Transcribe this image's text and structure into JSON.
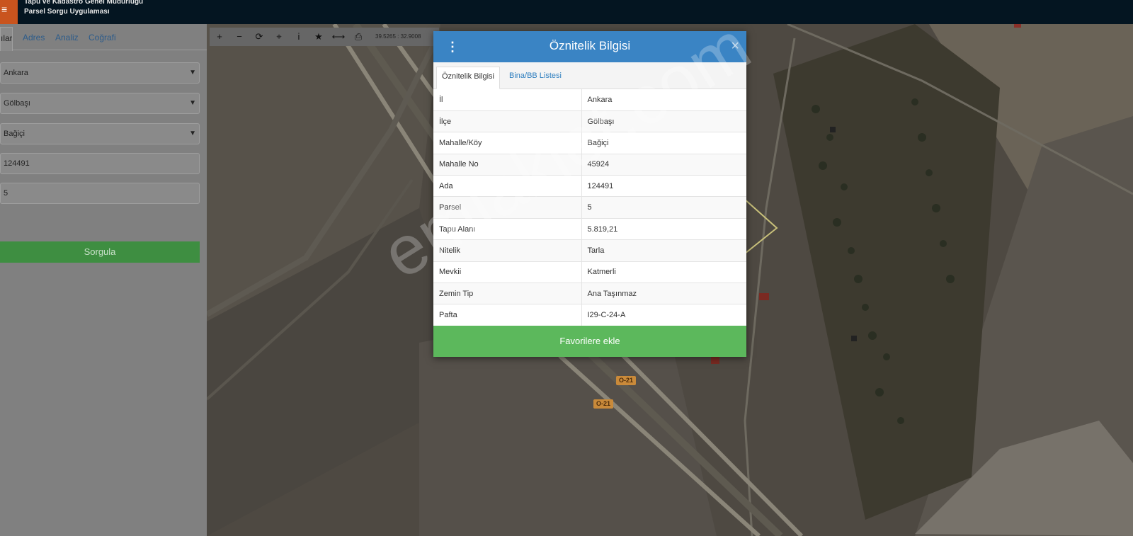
{
  "header": {
    "title_line1": "Tapu ve Kadastro Genel Müdürlüğü",
    "title_line2": "Parsel Sorgu Uygulaması",
    "menu_icon": "≡"
  },
  "sidebar": {
    "tabs": [
      {
        "label": "ıları"
      },
      {
        "label": "Adres"
      },
      {
        "label": "Analiz"
      },
      {
        "label": "Coğrafi"
      }
    ],
    "fields": [
      {
        "value": "Ankara",
        "type": "select"
      },
      {
        "value": "Gölbaşı",
        "type": "select"
      },
      {
        "value": "Bağiçi",
        "type": "select"
      },
      {
        "value": "124491",
        "type": "input"
      },
      {
        "value": "5",
        "type": "input"
      }
    ],
    "query_button": "Sorgula"
  },
  "map": {
    "toolbar": {
      "zoom_in": "+",
      "zoom_out": "−",
      "refresh": "⟳",
      "center": "⌖",
      "info": "i",
      "favorite": "★",
      "measure": "⟷",
      "print": "⎙",
      "coords": "39.5265 : 32.9008"
    },
    "road_signs": [
      "O-21",
      "O-21"
    ],
    "watermark": "emlakjet.com"
  },
  "modal": {
    "title": "Öznitelik Bilgisi",
    "close": "×",
    "menu_icon": "⋮",
    "tabs": [
      {
        "label": "Öznitelik Bilgisi",
        "active": true
      },
      {
        "label": "Bina/BB Listesi",
        "active": false
      }
    ],
    "rows": [
      {
        "key": "İl",
        "value": "Ankara"
      },
      {
        "key": "İlçe",
        "value": "Gölbaşı"
      },
      {
        "key": "Mahalle/Köy",
        "value": "Bağiçi"
      },
      {
        "key": "Mahalle No",
        "value": "45924"
      },
      {
        "key": "Ada",
        "value": "124491"
      },
      {
        "key": "Parsel",
        "value": "5"
      },
      {
        "key": "Tapu Alanı",
        "value": "5.819,21"
      },
      {
        "key": "Nitelik",
        "value": "Tarla"
      },
      {
        "key": "Mevkii",
        "value": "Katmerli"
      },
      {
        "key": "Zemin Tip",
        "value": "Ana Taşınmaz"
      },
      {
        "key": "Pafta",
        "value": "I29-C-24-A"
      }
    ],
    "favorite_button": "Favorilere ekle"
  },
  "colors": {
    "header_bg": "#041521",
    "menu_accent": "#c9541e",
    "modal_header": "#3a84c4",
    "favorite_green": "#5cb85c",
    "query_green": "#3e8e41"
  }
}
